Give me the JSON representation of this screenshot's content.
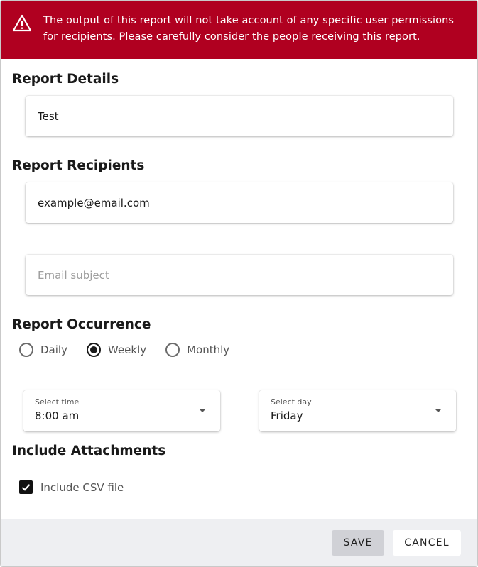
{
  "alert": {
    "icon": "warning-triangle-icon",
    "background": "#b00020",
    "message": "The output of this report will not take account of any specific user permissions for recipients. Please carefully consider the people receiving this report."
  },
  "report_details": {
    "title": "Report Details",
    "name_value": "Test"
  },
  "report_recipients": {
    "title": "Report Recipients",
    "email_value": "example@email.com",
    "subject_placeholder": "Email subject",
    "subject_value": ""
  },
  "report_occurrence": {
    "title": "Report Occurrence",
    "options": [
      {
        "label": "Daily",
        "checked": false
      },
      {
        "label": "Weekly",
        "checked": true
      },
      {
        "label": "Monthly",
        "checked": false
      }
    ],
    "time": {
      "label": "Select time",
      "value": "8:00 am"
    },
    "day": {
      "label": "Select day",
      "value": "Friday"
    }
  },
  "attachments": {
    "title": "Include Attachments",
    "csv_label": "Include CSV file",
    "csv_checked": true
  },
  "footer": {
    "save_label": "SAVE",
    "cancel_label": "CANCEL"
  }
}
